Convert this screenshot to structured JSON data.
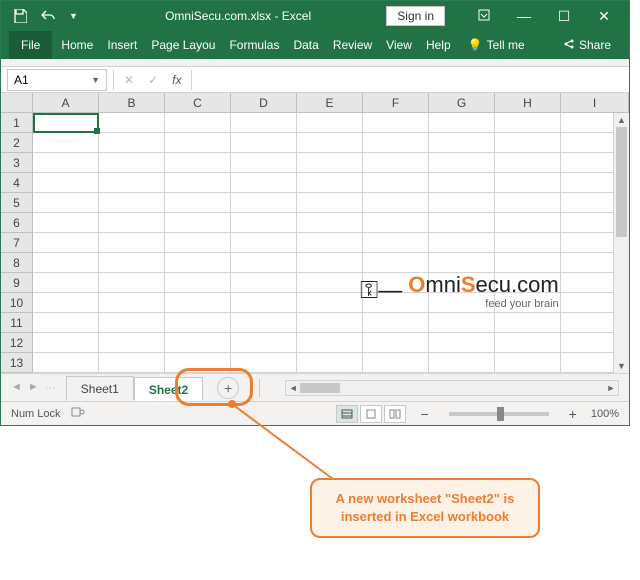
{
  "titlebar": {
    "title": "OmniSecu.com.xlsx - Excel",
    "signin": "Sign in"
  },
  "ribbon": {
    "file": "File",
    "tabs": [
      "Home",
      "Insert",
      "Page Layou",
      "Formulas",
      "Data",
      "Review",
      "View",
      "Help"
    ],
    "tellme": "Tell me",
    "share": "Share"
  },
  "formula": {
    "namebox": "A1",
    "fx": "fx"
  },
  "columns": [
    "A",
    "B",
    "C",
    "D",
    "E",
    "F",
    "G",
    "H",
    "I"
  ],
  "rows": [
    "1",
    "2",
    "3",
    "4",
    "5",
    "6",
    "7",
    "8",
    "9",
    "10",
    "11",
    "12",
    "13"
  ],
  "sheets": {
    "tab1": "Sheet1",
    "tab2": "Sheet2",
    "new": "+"
  },
  "status": {
    "numlock": "Num Lock",
    "zoom": "100%"
  },
  "annotation": {
    "text": "A new worksheet \"Sheet2\" is inserted in Excel workbook"
  },
  "watermark": {
    "brand_pre": "mni",
    "brand_hi": "S",
    "brand_post": "ecu.com",
    "tag": "feed your brain"
  }
}
